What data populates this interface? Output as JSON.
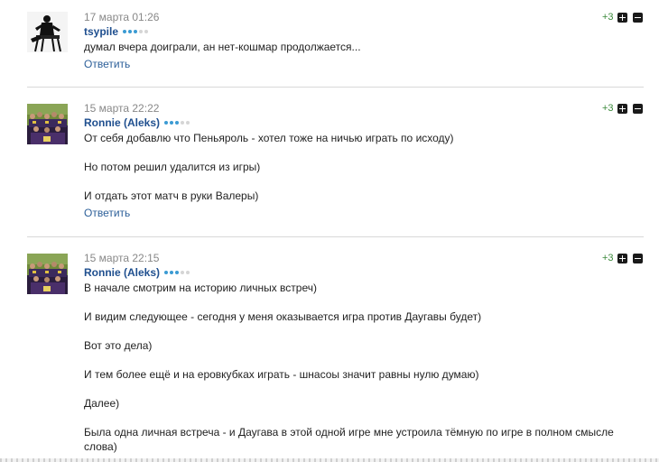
{
  "comments": [
    {
      "date": "17 марта 01:26",
      "author": "tsypile",
      "rating_dots": {
        "filled": 3,
        "total": 5
      },
      "score": "+3",
      "avatar_icon": "person-in-chair-avatar",
      "paragraphs": [
        "думал вчера доиграли, ан нет-кошмар продолжается..."
      ],
      "reply": "Ответить"
    },
    {
      "date": "15 марта 22:22",
      "author": "Ronnie (Aleks)",
      "rating_dots": {
        "filled": 3,
        "total": 5
      },
      "score": "+3",
      "avatar_icon": "team-photo-avatar",
      "paragraphs": [
        "От себя добавлю что Пеньяроль - хотел тоже на ничью играть по исходу)",
        "Но потом решил удалится из игры)",
        "И отдать этот матч в руки Валеры)"
      ],
      "reply": "Ответить"
    },
    {
      "date": "15 марта 22:15",
      "author": "Ronnie (Aleks)",
      "rating_dots": {
        "filled": 3,
        "total": 5
      },
      "score": "+3",
      "avatar_icon": "team-photo-avatar",
      "paragraphs": [
        "В начале смотрим на историю личных встреч)",
        "И видим следующее - сегодня у меня оказывается игра против Даугавы будет)",
        "Вот это дела)",
        "И тем более ещё и на еровкубках играть - шнасоы значит равны нулю думаю)",
        "Далее)",
        "Была одна личная встреча - и Даугава в этой одной игре мне устроила тёмную по игре в полном смысле слова)"
      ]
    }
  ],
  "colors": {
    "author": "#1f4f8f",
    "link": "#2c5f99",
    "date": "#888888",
    "score": "#3c8a3c",
    "dot_on": "#3b9bd3",
    "dot_off": "#d5d5d5",
    "divider": "#d8d8d8"
  }
}
